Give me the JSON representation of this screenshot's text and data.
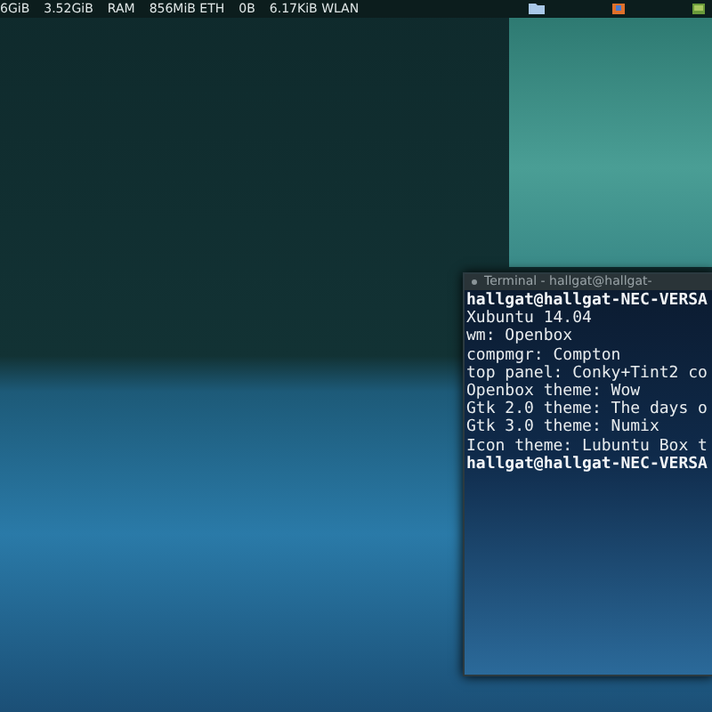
{
  "panel": {
    "items": [
      "6GiB",
      "3.52GiB",
      "RAM",
      "856MiB ETH",
      "0B",
      "6.17KiB WLAN"
    ]
  },
  "terminal": {
    "title": "Terminal - hallgat@hallgat-",
    "lines": [
      {
        "text": "hallgat@hallgat-NEC-VERSA",
        "kind": "prompt"
      },
      {
        "text": "Xubuntu 14.04",
        "kind": "output"
      },
      {
        "text": "wm: Openbox",
        "kind": "output"
      },
      {
        "text": "compmgr: Compton",
        "kind": "output"
      },
      {
        "text": "top panel: Conky+Tint2 co",
        "kind": "output"
      },
      {
        "text": "Openbox theme: Wow",
        "kind": "output"
      },
      {
        "text": "Gtk 2.0 theme: The days o",
        "kind": "output"
      },
      {
        "text": "Gtk 3.0 theme: Numix",
        "kind": "output"
      },
      {
        "text": "Icon theme: Lubuntu Box t",
        "kind": "output"
      },
      {
        "text": "hallgat@hallgat-NEC-VERSA",
        "kind": "prompt"
      }
    ]
  }
}
